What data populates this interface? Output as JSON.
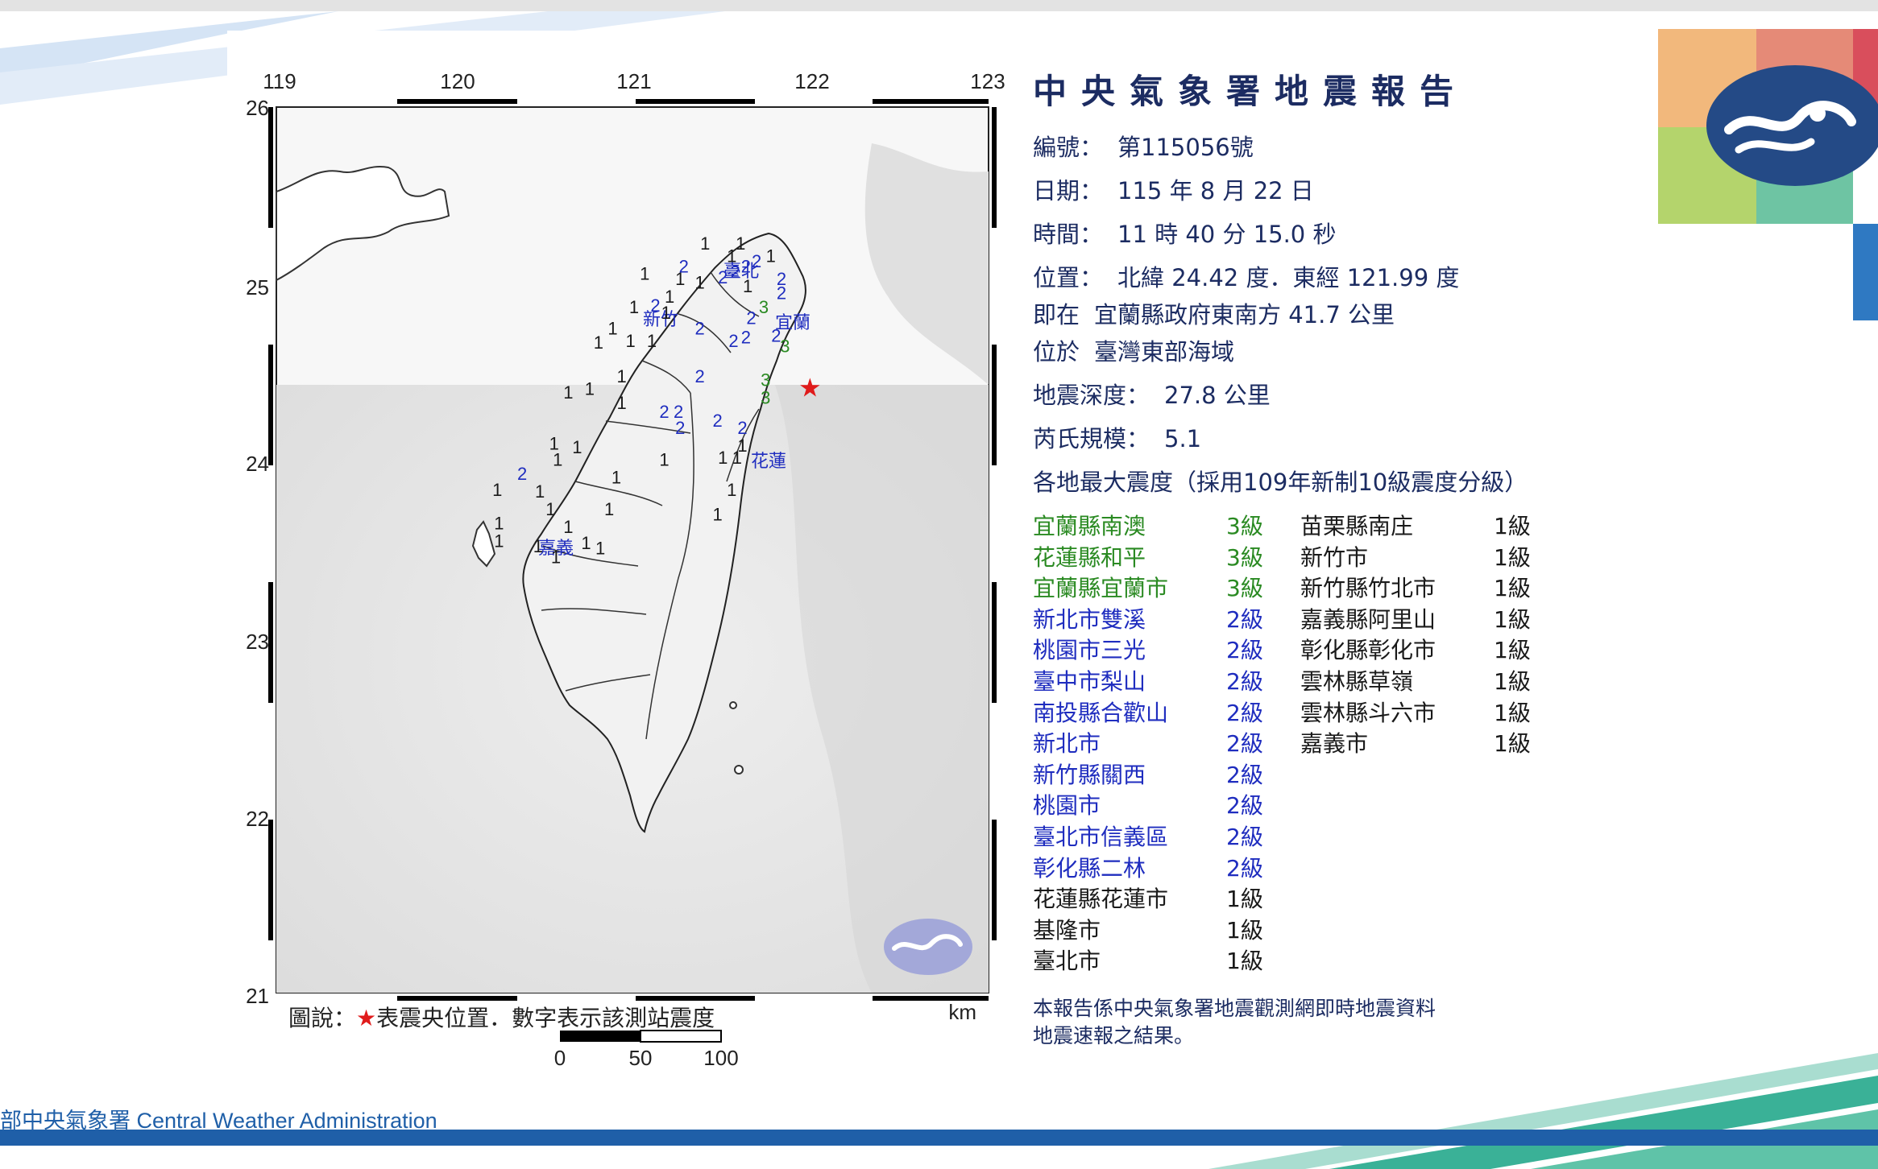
{
  "report": {
    "title": "中央氣象署地震報告",
    "number_label": "編號：",
    "number": "第115056號",
    "date_label": "日期：",
    "date": "115 年 8 月 22 日",
    "time_label": "時間：",
    "time": "11 時 40 分 15.0 秒",
    "location_label": "位置：",
    "location": "北緯 24.42 度．東經 121.99 度",
    "near_label": "即在",
    "near": "宜蘭縣政府東南方 41.7 公里",
    "region_label": "位於",
    "region": "臺灣東部海域",
    "depth_label": "地震深度：",
    "depth": "27.8 公里",
    "magnitude_label": "芮氏規模：",
    "magnitude": "5.1",
    "intensity_heading": "各地最大震度（採用109年新制10級震度分級）",
    "note_line1": "本報告係中央氣象署地震觀測網即時地震資料",
    "note_line2": "地震速報之結果。"
  },
  "intensity_left": [
    {
      "name": "宜蘭縣南澳",
      "level": "3級",
      "cls": "lvl-3"
    },
    {
      "name": "花蓮縣和平",
      "level": "3級",
      "cls": "lvl-3"
    },
    {
      "name": "宜蘭縣宜蘭市",
      "level": "3級",
      "cls": "lvl-3"
    },
    {
      "name": "新北市雙溪",
      "level": "2級",
      "cls": "lvl-2"
    },
    {
      "name": "桃園市三光",
      "level": "2級",
      "cls": "lvl-2"
    },
    {
      "name": "臺中市梨山",
      "level": "2級",
      "cls": "lvl-2"
    },
    {
      "name": "南投縣合歡山",
      "level": "2級",
      "cls": "lvl-2"
    },
    {
      "name": "新北市",
      "level": "2級",
      "cls": "lvl-2"
    },
    {
      "name": "新竹縣關西",
      "level": "2級",
      "cls": "lvl-2"
    },
    {
      "name": "桃園市",
      "level": "2級",
      "cls": "lvl-2"
    },
    {
      "name": "臺北市信義區",
      "level": "2級",
      "cls": "lvl-2"
    },
    {
      "name": "彰化縣二林",
      "level": "2級",
      "cls": "lvl-2"
    },
    {
      "name": "花蓮縣花蓮市",
      "level": "1級",
      "cls": "lvl-1"
    },
    {
      "name": "基隆市",
      "level": "1級",
      "cls": "lvl-1"
    },
    {
      "name": "臺北市",
      "level": "1級",
      "cls": "lvl-1"
    }
  ],
  "intensity_right": [
    {
      "name": "苗栗縣南庄",
      "level": "1級",
      "cls": "lvl-1"
    },
    {
      "name": "新竹市",
      "level": "1級",
      "cls": "lvl-1"
    },
    {
      "name": "新竹縣竹北市",
      "level": "1級",
      "cls": "lvl-1"
    },
    {
      "name": "嘉義縣阿里山",
      "level": "1級",
      "cls": "lvl-1"
    },
    {
      "name": "彰化縣彰化市",
      "level": "1級",
      "cls": "lvl-1"
    },
    {
      "name": "雲林縣草嶺",
      "level": "1級",
      "cls": "lvl-1"
    },
    {
      "name": "雲林縣斗六市",
      "level": "1級",
      "cls": "lvl-1"
    },
    {
      "name": "嘉義市",
      "level": "1級",
      "cls": "lvl-1"
    }
  ],
  "map": {
    "lon_ticks": [
      "119",
      "120",
      "121",
      "122",
      "123"
    ],
    "lat_ticks": [
      "26",
      "25",
      "24",
      "23",
      "22",
      "21"
    ],
    "legend_prefix": "圖說：",
    "legend_star": "★",
    "legend_text": "表震央位置．數字表示該測站震度",
    "scale_unit": "km",
    "scale_labels": [
      "0",
      "50",
      "100"
    ],
    "city_labels": [
      "臺北",
      "新竹",
      "宜蘭",
      "花蓮",
      "嘉義"
    ],
    "epicenter": {
      "lon": 121.99,
      "lat": 24.42
    },
    "stations": [
      {
        "v": "1",
        "lon": 121.6,
        "lat": 25.2,
        "c": "lvl-1"
      },
      {
        "v": "1",
        "lon": 121.77,
        "lat": 25.13,
        "c": "lvl-1"
      },
      {
        "v": "2",
        "lon": 121.69,
        "lat": 25.1,
        "c": "lvl-2"
      },
      {
        "v": "2",
        "lon": 121.63,
        "lat": 25.07,
        "c": "lvl-2"
      },
      {
        "v": "1",
        "lon": 121.4,
        "lat": 25.2,
        "c": "lvl-1"
      },
      {
        "v": "1",
        "lon": 121.55,
        "lat": 25.13,
        "c": "lvl-1"
      },
      {
        "v": "2",
        "lon": 121.57,
        "lat": 25.04,
        "c": "lvl-2"
      },
      {
        "v": "2",
        "lon": 121.5,
        "lat": 25.01,
        "c": "lvl-2"
      },
      {
        "v": "2",
        "lon": 121.83,
        "lat": 25.0,
        "c": "lvl-2"
      },
      {
        "v": "1",
        "lon": 121.06,
        "lat": 25.03,
        "c": "lvl-1"
      },
      {
        "v": "1",
        "lon": 121.26,
        "lat": 25.0,
        "c": "lvl-1"
      },
      {
        "v": "2",
        "lon": 121.28,
        "lat": 25.07,
        "c": "lvl-2"
      },
      {
        "v": "1",
        "lon": 121.64,
        "lat": 24.96,
        "c": "lvl-1"
      },
      {
        "v": "1",
        "lon": 121.37,
        "lat": 24.98,
        "c": "lvl-1"
      },
      {
        "v": "1",
        "lon": 121.2,
        "lat": 24.9,
        "c": "lvl-1"
      },
      {
        "v": "1",
        "lon": 121.0,
        "lat": 24.84,
        "c": "lvl-1"
      },
      {
        "v": "2",
        "lon": 121.12,
        "lat": 24.85,
        "c": "lvl-2"
      },
      {
        "v": "1",
        "lon": 121.18,
        "lat": 24.81,
        "c": "lvl-1"
      },
      {
        "v": "2",
        "lon": 121.83,
        "lat": 24.92,
        "c": "lvl-2"
      },
      {
        "v": "3",
        "lon": 121.73,
        "lat": 24.84,
        "c": "lvl-3"
      },
      {
        "v": "2",
        "lon": 121.66,
        "lat": 24.78,
        "c": "lvl-2"
      },
      {
        "v": "2",
        "lon": 121.37,
        "lat": 24.72,
        "c": "lvl-2"
      },
      {
        "v": "2",
        "lon": 121.56,
        "lat": 24.65,
        "c": "lvl-2"
      },
      {
        "v": "2",
        "lon": 121.63,
        "lat": 24.67,
        "c": "lvl-2"
      },
      {
        "v": "2",
        "lon": 121.8,
        "lat": 24.68,
        "c": "lvl-2"
      },
      {
        "v": "3",
        "lon": 121.85,
        "lat": 24.62,
        "c": "lvl-3"
      },
      {
        "v": "1",
        "lon": 120.88,
        "lat": 24.72,
        "c": "lvl-1"
      },
      {
        "v": "1",
        "lon": 120.98,
        "lat": 24.65,
        "c": "lvl-1"
      },
      {
        "v": "1",
        "lon": 121.1,
        "lat": 24.65,
        "c": "lvl-1"
      },
      {
        "v": "1",
        "lon": 120.8,
        "lat": 24.64,
        "c": "lvl-1"
      },
      {
        "v": "1",
        "lon": 120.93,
        "lat": 24.45,
        "c": "lvl-1"
      },
      {
        "v": "2",
        "lon": 121.37,
        "lat": 24.45,
        "c": "lvl-2"
      },
      {
        "v": "3",
        "lon": 121.74,
        "lat": 24.43,
        "c": "lvl-3"
      },
      {
        "v": "3",
        "lon": 121.74,
        "lat": 24.33,
        "c": "lvl-3"
      },
      {
        "v": "1",
        "lon": 120.63,
        "lat": 24.36,
        "c": "lvl-1"
      },
      {
        "v": "1",
        "lon": 120.75,
        "lat": 24.38,
        "c": "lvl-1"
      },
      {
        "v": "1",
        "lon": 120.93,
        "lat": 24.3,
        "c": "lvl-1"
      },
      {
        "v": "2",
        "lon": 121.17,
        "lat": 24.25,
        "c": "lvl-2"
      },
      {
        "v": "2",
        "lon": 121.25,
        "lat": 24.25,
        "c": "lvl-2"
      },
      {
        "v": "2",
        "lon": 121.26,
        "lat": 24.16,
        "c": "lvl-2"
      },
      {
        "v": "2",
        "lon": 121.47,
        "lat": 24.2,
        "c": "lvl-2"
      },
      {
        "v": "2",
        "lon": 121.61,
        "lat": 24.16,
        "c": "lvl-2"
      },
      {
        "v": "1",
        "lon": 121.61,
        "lat": 24.06,
        "c": "lvl-1"
      },
      {
        "v": "1",
        "lon": 120.55,
        "lat": 24.07,
        "c": "lvl-1"
      },
      {
        "v": "1",
        "lon": 120.68,
        "lat": 24.05,
        "c": "lvl-1"
      },
      {
        "v": "1",
        "lon": 120.57,
        "lat": 23.98,
        "c": "lvl-1"
      },
      {
        "v": "1",
        "lon": 121.17,
        "lat": 23.98,
        "c": "lvl-1"
      },
      {
        "v": "1",
        "lon": 121.5,
        "lat": 23.99,
        "c": "lvl-1"
      },
      {
        "v": "1",
        "lon": 121.58,
        "lat": 23.99,
        "c": "lvl-1"
      },
      {
        "v": "2",
        "lon": 120.37,
        "lat": 23.9,
        "c": "lvl-2"
      },
      {
        "v": "1",
        "lon": 120.9,
        "lat": 23.88,
        "c": "lvl-1"
      },
      {
        "v": "1",
        "lon": 120.23,
        "lat": 23.81,
        "c": "lvl-1"
      },
      {
        "v": "1",
        "lon": 120.47,
        "lat": 23.8,
        "c": "lvl-1"
      },
      {
        "v": "1",
        "lon": 121.55,
        "lat": 23.81,
        "c": "lvl-1"
      },
      {
        "v": "1",
        "lon": 120.53,
        "lat": 23.7,
        "c": "lvl-1"
      },
      {
        "v": "1",
        "lon": 120.86,
        "lat": 23.7,
        "c": "lvl-1"
      },
      {
        "v": "1",
        "lon": 121.47,
        "lat": 23.67,
        "c": "lvl-1"
      },
      {
        "v": "1",
        "lon": 120.24,
        "lat": 23.62,
        "c": "lvl-1"
      },
      {
        "v": "1",
        "lon": 120.63,
        "lat": 23.6,
        "c": "lvl-1"
      },
      {
        "v": "1",
        "lon": 120.24,
        "lat": 23.52,
        "c": "lvl-1"
      },
      {
        "v": "1",
        "lon": 120.46,
        "lat": 23.49,
        "c": "lvl-1"
      },
      {
        "v": "1",
        "lon": 120.73,
        "lat": 23.51,
        "c": "lvl-1"
      },
      {
        "v": "1",
        "lon": 120.81,
        "lat": 23.48,
        "c": "lvl-1"
      },
      {
        "v": "1",
        "lon": 120.56,
        "lat": 23.43,
        "c": "lvl-1"
      }
    ]
  },
  "footer": {
    "text": "部中央氣象署 Central Weather Administration"
  },
  "colors": {
    "navy": "#1c2c62",
    "level3": "#2a8a22",
    "level2": "#1f2dbf",
    "level1": "#1a1a1a",
    "epicenter": "#e01b1b",
    "footer_blue": "#1f5fa8",
    "swoosh_teal": "#3ab197"
  }
}
